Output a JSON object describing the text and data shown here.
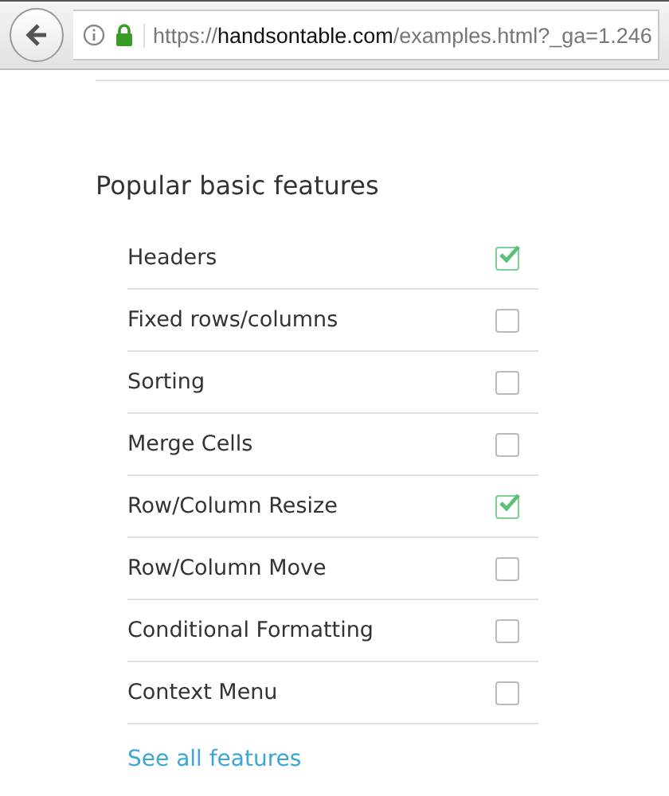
{
  "address_bar": {
    "scheme": "https://",
    "host": "handsontable.com",
    "path": "/examples.html?_ga=1.246"
  },
  "section": {
    "title": "Popular basic features",
    "features": [
      {
        "label": "Headers",
        "checked": true
      },
      {
        "label": "Fixed rows/columns",
        "checked": false
      },
      {
        "label": "Sorting",
        "checked": false
      },
      {
        "label": "Merge Cells",
        "checked": false
      },
      {
        "label": "Row/Column Resize",
        "checked": true
      },
      {
        "label": "Row/Column Move",
        "checked": false
      },
      {
        "label": "Conditional Formatting",
        "checked": false
      },
      {
        "label": "Context Menu",
        "checked": false
      }
    ],
    "link": "See all features"
  }
}
